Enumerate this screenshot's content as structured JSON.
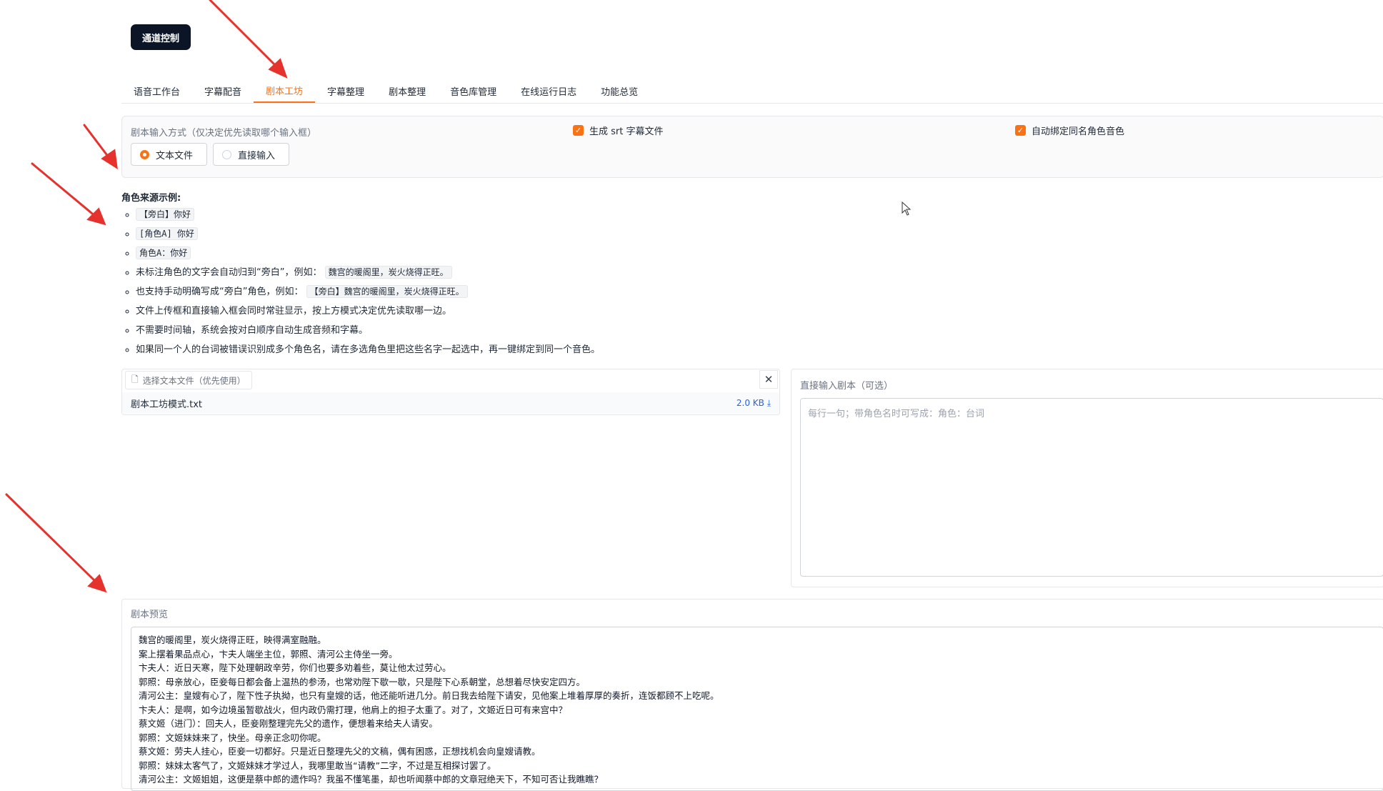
{
  "channel_button": "通道控制",
  "tabs": [
    {
      "label": "语音工作台"
    },
    {
      "label": "字幕配音"
    },
    {
      "label": "剧本工坊",
      "active": true
    },
    {
      "label": "字幕整理"
    },
    {
      "label": "剧本整理"
    },
    {
      "label": "音色库管理"
    },
    {
      "label": "在线运行日志"
    },
    {
      "label": "功能总览"
    }
  ],
  "input_mode": {
    "label": "剧本输入方式（仅决定优先读取哪个输入框）",
    "options": [
      {
        "label": "文本文件",
        "selected": true
      },
      {
        "label": "直接输入",
        "selected": false
      }
    ]
  },
  "options": {
    "srt": {
      "label": "生成 srt 字幕文件",
      "checked": true
    },
    "auto_bind": {
      "label": "自动绑定同名角色音色",
      "checked": true
    }
  },
  "examples": {
    "title": "角色来源示例:",
    "item1_code": "【旁白】你好",
    "item2_code": "[角色A] 你好",
    "item3_code": "角色A：你好",
    "item4_text": "未标注角色的文字会自动归到“旁白”，例如：",
    "item4_code": "魏宫的暖阁里，炭火烧得正旺。",
    "item5_text": "也支持手动明确写成“旁白”角色，例如：",
    "item5_code": "【旁白】魏宫的暖阁里，炭火烧得正旺。",
    "item6": "文件上传框和直接输入框会同时常驻显示，按上方模式决定优先读取哪一边。",
    "item7": "不需要时间轴，系统会按对白顺序自动生成音频和字幕。",
    "item8": "如果同一个人的台词被错误识别成多个角色名，请在多选角色里把这些名字一起选中，再一键绑定到同一个音色。"
  },
  "file_upload": {
    "tag_label": "选择文本文件（优先使用）",
    "file_name": "剧本工坊模式.txt",
    "file_size": "2.0 KB ⤓"
  },
  "direct_input": {
    "label": "直接输入剧本（可选）",
    "placeholder": "每行一句；带角色名时可写成：角色：台词"
  },
  "preview": {
    "label": "剧本预览",
    "lines": [
      "魏宫的暖阁里，炭火烧得正旺，映得满室融融。",
      "案上摆着果品点心，卞夫人端坐主位，郭照、清河公主侍坐一旁。",
      "卞夫人：近日天寒，陛下处理朝政辛劳，你们也要多劝着些，莫让他太过劳心。",
      "郭照：母亲放心，臣妾每日都会备上温热的参汤，也常劝陛下歇一歇，只是陛下心系朝堂，总想着尽快安定四方。",
      "清河公主：皇嫂有心了，陛下性子执拗，也只有皇嫂的话，他还能听进几分。前日我去给陛下请安，见他案上堆着厚厚的奏折，连饭都顾不上吃呢。",
      "卞夫人：是啊，如今边境虽暂歇战火，但内政仍需打理，他肩上的担子太重了。对了，文姬近日可有来宫中？",
      "蔡文姬（进门）：回夫人，臣妾刚整理完先父的遗作，便想着来给夫人请安。",
      "郭照：文姬妹妹来了，快坐。母亲正念叨你呢。",
      "蔡文姬：劳夫人挂心，臣妾一切都好。只是近日整理先父的文稿，偶有困惑，正想找机会向皇嫂请教。",
      "郭照：妹妹太客气了，文姬妹妹才学过人，我哪里敢当“请教”二字，不过是互相探讨罢了。",
      "清河公主：文姬姐姐，这便是蔡中郎的遗作吗？我虽不懂笔墨，却也听闻蔡中郎的文章冠绝天下，不知可否让我瞧瞧？"
    ]
  }
}
